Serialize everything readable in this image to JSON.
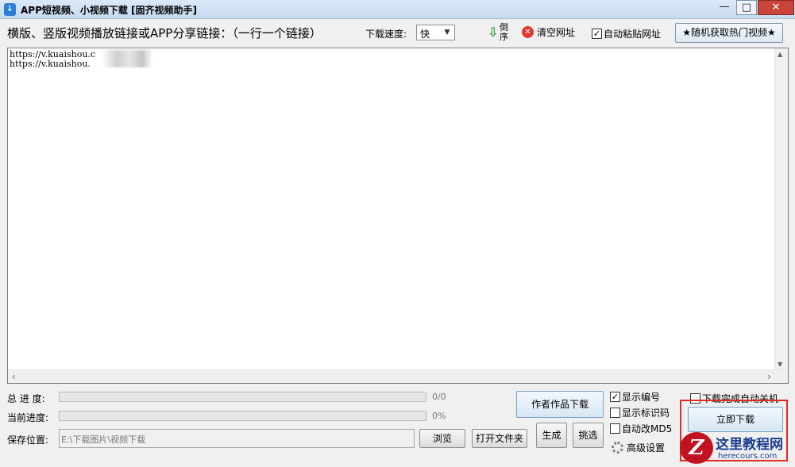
{
  "window": {
    "title": "APP短视频、小视频下载 [固齐视频助手]",
    "app_icon": "app-icon",
    "min_glyph": "—",
    "max_glyph": "□",
    "close_glyph": "✕"
  },
  "toolbar": {
    "instruction": "横版、竖版视频播放链接或APP分享链接：（一行一个链接）",
    "speed_label": "下载速度:",
    "speed_value": "快",
    "reverse_label": "倒序",
    "clear_label": "清空网址",
    "autopaste_label": "自动粘贴网址",
    "autopaste_checked": true,
    "hot_button": "★随机获取热门视频★"
  },
  "url_list": {
    "lines": [
      "https://v.kuaishou.c",
      "https://v.kuaishou."
    ]
  },
  "progress": {
    "total_label": "总 进 度:",
    "total_text": "0/0",
    "total_fraction": 0,
    "current_label": "当前进度:",
    "current_text": "0%",
    "current_fraction": 0
  },
  "save": {
    "label": "保存位置:",
    "path": "E:\\下载图片\\视频下载",
    "browse_button": "浏览",
    "open_folder_button": "打开文件夹"
  },
  "actions": {
    "author_works_button": "作者作品下载",
    "generate_button": "生成",
    "pick_button": "挑选",
    "download_now_button": "立即下载",
    "advanced_settings": "高级设置"
  },
  "options": {
    "show_number_label": "显示编号",
    "show_number_checked": true,
    "show_id_label": "显示标识码",
    "show_id_checked": false,
    "auto_md5_label": "自动改MD5",
    "auto_md5_checked": false,
    "shutdown_label": "下载完成自动关机",
    "shutdown_checked": false
  },
  "watermark": {
    "logo_letter": "Z",
    "title": "这里教程网",
    "url": "herecours.com"
  },
  "colors": {
    "progress_fill": "#06b025",
    "highlight_border": "#e32a22",
    "title_bar": "#c6daf0",
    "clear_icon": "#e03a2e"
  }
}
